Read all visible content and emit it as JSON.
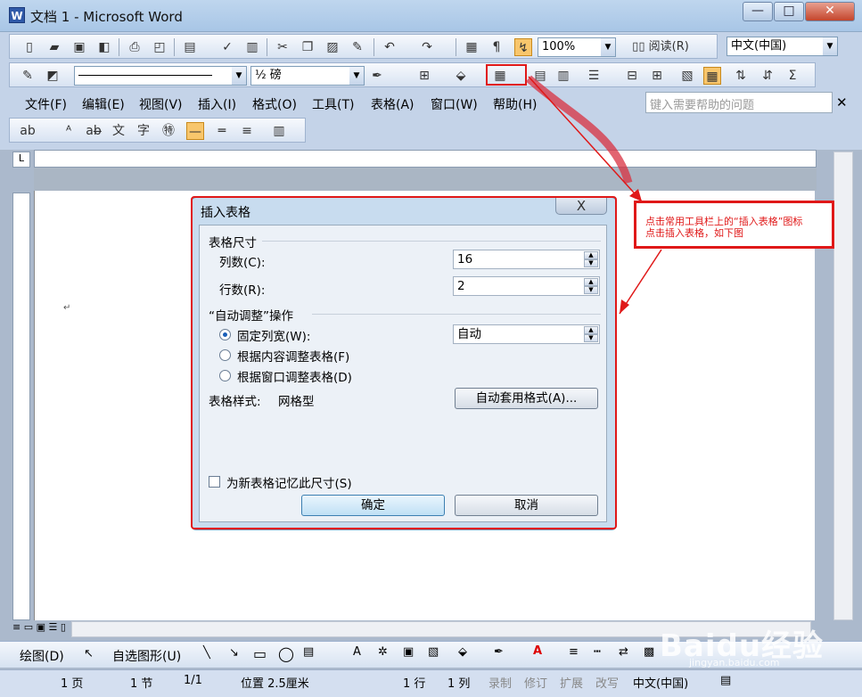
{
  "window": {
    "title": "文档 1 - Microsoft Word",
    "min": "—",
    "max": "□",
    "close": "✕"
  },
  "toolbar1": {
    "zoom": "100%",
    "read_label": "阅读(R)",
    "language": "中文(中国)"
  },
  "toolbar2": {
    "line_weight": "½ 磅"
  },
  "menu": {
    "items": [
      "文件(F)",
      "编辑(E)",
      "视图(V)",
      "插入(I)",
      "格式(O)",
      "工具(T)",
      "表格(A)",
      "窗口(W)",
      "帮助(H)"
    ],
    "help_placeholder": "键入需要帮助的问题"
  },
  "dialog": {
    "title": "插入表格",
    "close": "X",
    "size_group": "表格尺寸",
    "cols_label": "列数(C):",
    "cols_value": "16",
    "rows_label": "行数(R):",
    "rows_value": "2",
    "autofit_group": "“自动调整”操作",
    "fixed_label": "固定列宽(W):",
    "fixed_value": "自动",
    "fit_content_label": "根据内容调整表格(F)",
    "fit_window_label": "根据窗口调整表格(D)",
    "style_label": "表格样式:",
    "style_value": "网格型",
    "autoformat_button": "自动套用格式(A)...",
    "remember_label": "为新表格记忆此尺寸(S)",
    "ok": "确定",
    "cancel": "取消"
  },
  "annotation": {
    "line1": "点击常用工具栏上的“插入表格”图标",
    "line2": "点击插入表格，如下图"
  },
  "drawbar": {
    "draw_label": "绘图(D)",
    "autoshape_label": "自选图形(U)"
  },
  "status": {
    "page": "1 页",
    "section": "1 节",
    "pages": "1/1",
    "position": "位置 2.5厘米",
    "line": "1 行",
    "col": "1 列",
    "rec": "录制",
    "trk": "修订",
    "ext": "扩展",
    "ovr": "改写",
    "lang": "中文(中国)"
  },
  "watermark": {
    "brand": "Baidu经验",
    "url": "jingyan.baidu.com"
  }
}
